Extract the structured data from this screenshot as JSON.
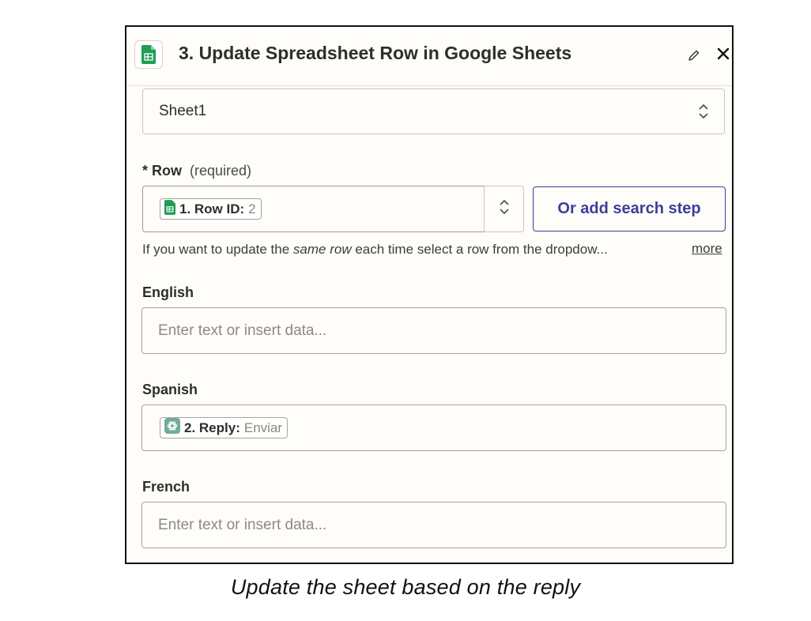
{
  "header": {
    "title": "3. Update Spreadsheet Row in Google Sheets",
    "app_icon": "google-sheets-icon",
    "edit_icon": "pencil-icon",
    "close_icon": "close-icon"
  },
  "worksheet": {
    "value": "Sheet1"
  },
  "row": {
    "label": "* Row",
    "required": "(required)",
    "pill": {
      "label": "1. Row ID:",
      "value": "2",
      "icon": "google-sheets-icon"
    },
    "search_button": "Or add search step",
    "help_prefix": "If you want to update the ",
    "help_emphasis": "same row",
    "help_suffix": " each time select a row from the dropdow...",
    "more": "more"
  },
  "fields": {
    "english": {
      "label": "English",
      "placeholder": "Enter text or insert data..."
    },
    "spanish": {
      "label": "Spanish",
      "pill": {
        "label": "2. Reply:",
        "value": "Enviar",
        "icon": "openai-icon"
      }
    },
    "french": {
      "label": "French",
      "placeholder": "Enter text or insert data..."
    }
  },
  "caption": "Update the sheet based on the reply",
  "colors": {
    "accent": "#3b3f99",
    "sheets_green": "#1f9d55",
    "panel_bg": "#fffdf9"
  }
}
